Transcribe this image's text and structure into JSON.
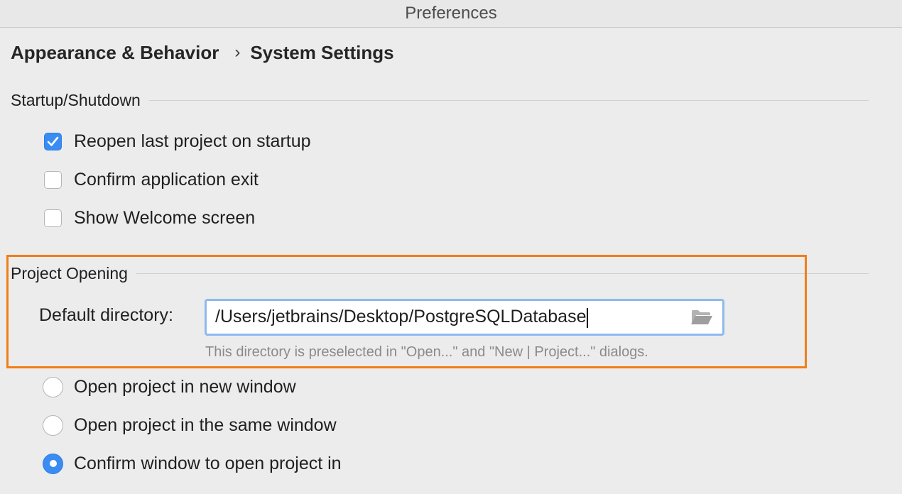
{
  "window": {
    "title": "Preferences"
  },
  "breadcrumb": {
    "items": [
      "Appearance & Behavior",
      "System Settings"
    ],
    "separator": "›"
  },
  "startup": {
    "header": "Startup/Shutdown",
    "options": [
      {
        "label": "Reopen last project on startup",
        "checked": true
      },
      {
        "label": "Confirm application exit",
        "checked": false
      },
      {
        "label": "Show Welcome screen",
        "checked": false
      }
    ]
  },
  "project_opening": {
    "header": "Project Opening",
    "default_directory_label": "Default directory:",
    "default_directory_value": "/Users/jetbrains/Desktop/PostgreSQLDatabase",
    "hint": "This directory is preselected in \"Open...\" and \"New | Project...\" dialogs.",
    "options": [
      {
        "label": "Open project in new window",
        "selected": false
      },
      {
        "label": "Open project in the same window",
        "selected": false
      },
      {
        "label": "Confirm window to open project in",
        "selected": true
      }
    ]
  },
  "colors": {
    "accent": "#3a8cf2",
    "highlight": "#f27e17",
    "focus_ring": "#8fb9ef",
    "background": "#ececec"
  },
  "icons": {
    "checkbox_checked": "checkmark-icon",
    "folder": "folder-icon"
  }
}
